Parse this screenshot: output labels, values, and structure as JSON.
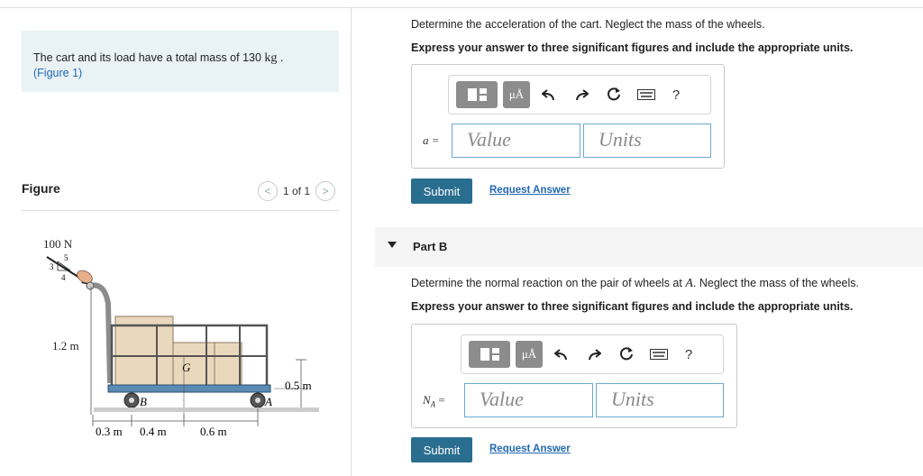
{
  "problem": {
    "text_before": "The cart and its load have a total mass of 130 ",
    "mass_unit": "kg",
    "text_after": " .",
    "figure_link": "(Figure 1)"
  },
  "figure_panel": {
    "title": "Figure",
    "pager_prev": "<",
    "pager_text": "1 of 1",
    "pager_next": ">"
  },
  "figure": {
    "force_label": "100 N",
    "slope_3": "3",
    "slope_4": "4",
    "slope_5": "5",
    "height_label": "1.2 m",
    "wheel_clearance_label": "0.5 m",
    "point_g": "G",
    "point_b": "B",
    "point_a": "A",
    "dim_1": "0.3 m",
    "dim_2": "0.4 m",
    "dim_3": "0.6 m"
  },
  "part_a": {
    "question": "Determine the acceleration of the cart. Neglect the mass of the wheels.",
    "instruction": "Express your answer to three significant figures and include the appropriate units.",
    "var_label": "a =",
    "value_placeholder": "Value",
    "units_placeholder": "Units",
    "submit_label": "Submit",
    "request_label": "Request Answer"
  },
  "part_b": {
    "header": "Part B",
    "question_before": "Determine the normal reaction on the pair of wheels at ",
    "question_point": "A",
    "question_after": ". Neglect the mass of the wheels.",
    "instruction": "Express your answer to three significant figures and include the appropriate units.",
    "var_label_main": "N",
    "var_label_sub": "A",
    "var_label_eq": " =",
    "value_placeholder": "Value",
    "units_placeholder": "Units",
    "submit_label": "Submit",
    "request_label": "Request Answer"
  },
  "toolbar": {
    "templates_icon": "templates-icon",
    "units_symbol": "μÅ",
    "undo_icon": "undo-icon",
    "redo_icon": "redo-icon",
    "reset_icon": "reset-icon",
    "keyboard_icon": "keyboard-icon",
    "help_label": "?"
  },
  "colors": {
    "problem_bg": "#e9f3f6",
    "submit_bg": "#2a6e8f",
    "link": "#2268b2",
    "field_border": "#6ba8cc"
  }
}
